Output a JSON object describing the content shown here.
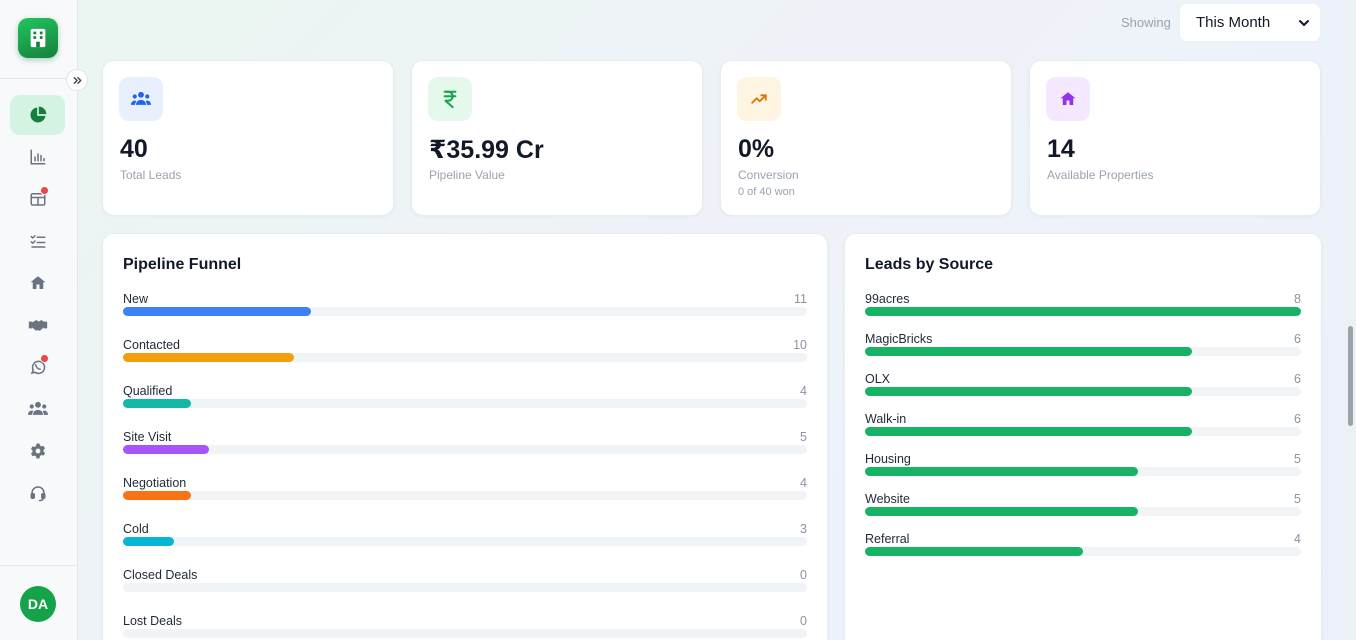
{
  "filter": {
    "showing_label": "Showing",
    "selected": "This Month"
  },
  "sidebar": {
    "items": [
      {
        "icon": "pie-chart-icon",
        "active": true,
        "badge": false
      },
      {
        "icon": "bar-chart-icon",
        "active": false,
        "badge": false
      },
      {
        "icon": "kanban-board-icon",
        "active": false,
        "badge": true
      },
      {
        "icon": "task-list-icon",
        "active": false,
        "badge": false
      },
      {
        "icon": "home-icon",
        "active": false,
        "badge": false
      },
      {
        "icon": "handshake-icon",
        "active": false,
        "badge": false
      },
      {
        "icon": "whatsapp-icon",
        "active": false,
        "badge": true
      },
      {
        "icon": "users-icon",
        "active": false,
        "badge": false
      },
      {
        "icon": "gear-icon",
        "active": false,
        "badge": false
      },
      {
        "icon": "headset-icon",
        "active": false,
        "badge": false
      }
    ],
    "avatar_initials": "DA"
  },
  "stats": [
    {
      "value": "40",
      "label": "Total Leads",
      "sub": "",
      "icon": "users-icon",
      "icon_color": "#2563eb",
      "icon_bg": "#e8f0fe"
    },
    {
      "value": "₹35.99 Cr",
      "label": "Pipeline Value",
      "sub": "",
      "icon": "rupee-icon",
      "icon_color": "#16a34a",
      "icon_bg": "#e4f8ec"
    },
    {
      "value": "0%",
      "label": "Conversion",
      "sub": "0 of 40 won",
      "icon": "trending-up-icon",
      "icon_color": "#d97706",
      "icon_bg": "#fdf4e1"
    },
    {
      "value": "14",
      "label": "Available Properties",
      "sub": "",
      "icon": "home-icon",
      "icon_color": "#9333ea",
      "icon_bg": "#f3e8fd"
    }
  ],
  "funnel": {
    "title": "Pipeline Funnel",
    "max": 40,
    "rows": [
      {
        "label": "New",
        "count": 11,
        "color": "#3b82f6"
      },
      {
        "label": "Contacted",
        "count": 10,
        "color": "#f59e0b"
      },
      {
        "label": "Qualified",
        "count": 4,
        "color": "#14b8a6"
      },
      {
        "label": "Site Visit",
        "count": 5,
        "color": "#a855f7"
      },
      {
        "label": "Negotiation",
        "count": 4,
        "color": "#f97316"
      },
      {
        "label": "Cold",
        "count": 3,
        "color": "#06b6d4"
      },
      {
        "label": "Closed Deals",
        "count": 0,
        "color": "#22c55e"
      },
      {
        "label": "Lost Deals",
        "count": 0,
        "color": "#ef4444"
      }
    ]
  },
  "sources": {
    "title": "Leads by Source",
    "max": 8,
    "color": "#16b364",
    "rows": [
      {
        "label": "99acres",
        "count": 8
      },
      {
        "label": "MagicBricks",
        "count": 6
      },
      {
        "label": "OLX",
        "count": 6
      },
      {
        "label": "Walk-in",
        "count": 6
      },
      {
        "label": "Housing",
        "count": 5
      },
      {
        "label": "Website",
        "count": 5
      },
      {
        "label": "Referral",
        "count": 4
      }
    ]
  }
}
